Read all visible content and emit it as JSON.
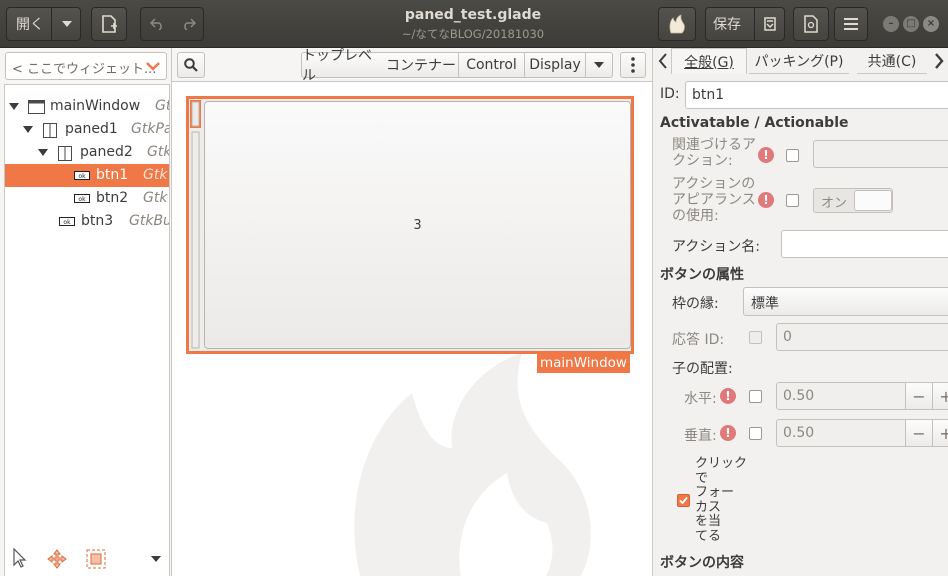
{
  "header": {
    "open_label": "開く",
    "title": "paned_test.glade",
    "subtitle": "~/なてなBLOG/20181030",
    "save_label": "保存"
  },
  "left": {
    "search_placeholder": "< ここでウィジェット...",
    "tree": [
      {
        "name": "mainWindow",
        "type": "Gt",
        "expanded": true,
        "icon": "window-icon"
      },
      {
        "name": "paned1",
        "type": "GtkPa",
        "expanded": true,
        "icon": "paned-icon"
      },
      {
        "name": "paned2",
        "type": "Gtk",
        "expanded": true,
        "icon": "paned-icon"
      },
      {
        "name": "btn1",
        "type": "Gtk",
        "selected": true,
        "icon": "button-icon"
      },
      {
        "name": "btn2",
        "type": "Gtk",
        "icon": "button-icon"
      },
      {
        "name": "btn3",
        "type": "GtkBu",
        "icon": "button-icon"
      }
    ]
  },
  "center": {
    "toolbar": {
      "toplevel": "トップレベル",
      "container": "コンテナー",
      "control": "Control",
      "display": "Display"
    },
    "button_label": "3",
    "window_label": "mainWindow"
  },
  "right": {
    "tabs": [
      "全般(G)",
      "パッキング(P)",
      "共通(C)"
    ],
    "id_label": "ID:",
    "id_value": "btn1",
    "section_actionable": "Activatable / Actionable",
    "related_action": "関連づけるア\nクション:",
    "action_appearance": "アクションの\nアピアランス\nの使用:",
    "toggle_on": "オン",
    "action_name": "アクション名:",
    "section_button": "ボタンの属性",
    "relief_label": "枠の縁:",
    "relief_value": "標準",
    "response_label": "応答 ID:",
    "response_value": "0",
    "child_pos": "子の配置:",
    "horizontal": "水平:",
    "horizontal_value": "0.50",
    "vertical": "垂直:",
    "vertical_value": "0.50",
    "focus_label": "クリック\nで\nフォー\nカス\nを当\nてる",
    "section_content": "ボタンの内容"
  },
  "colors": {
    "accent": "#f07746",
    "header": "#3c3b37"
  }
}
